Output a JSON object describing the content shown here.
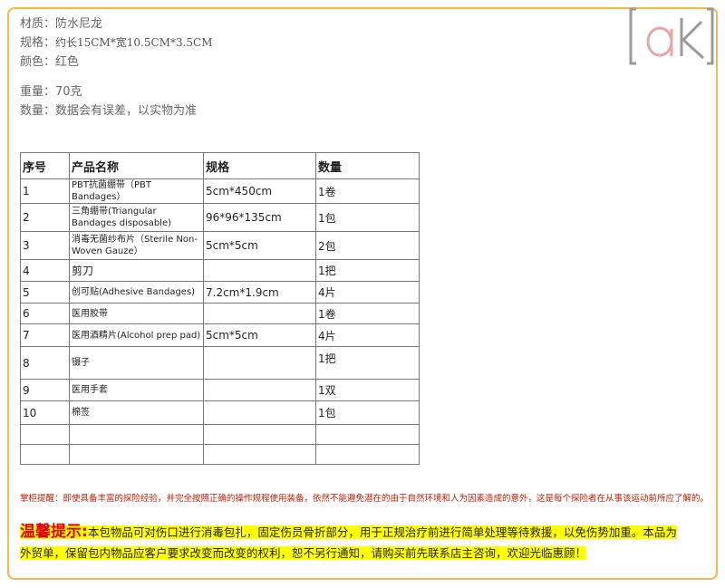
{
  "specs": {
    "material_label": "材质：",
    "material_value": "防水尼龙",
    "size_label": "规格：",
    "size_value": "约长15CM*宽10.5CM*3.5CM",
    "color_label": "颜色：",
    "color_value": "红色",
    "weight_label": "重量：",
    "weight_value": "70克",
    "quantity_label": "数量：",
    "quantity_value": "数据会有误差，以实物为准"
  },
  "table": {
    "headers": [
      "序号",
      "产品名称",
      "规格",
      "数量"
    ],
    "rows": [
      {
        "no": "1",
        "name": "PBT抗菌绷带（PBT Bandages）",
        "spec": "5cm*450cm",
        "qty": "1卷"
      },
      {
        "no": "2",
        "name": "三角绷带(Triangular Bandages disposable)",
        "spec": "96*96*135cm",
        "qty": "1包"
      },
      {
        "no": "3",
        "name": "消毒无菌纱布片（Sterile Non-Woven Gauze）",
        "spec": "5cm*5cm",
        "qty": "2包"
      },
      {
        "no": "4",
        "name": "剪刀",
        "spec": "",
        "qty": "1把"
      },
      {
        "no": "5",
        "name": "创可贴(Adhesive Bandages)",
        "spec": "7.2cm*1.9cm",
        "qty": "4片"
      },
      {
        "no": "6",
        "name": "医用胶带",
        "spec": "",
        "qty": "1卷"
      },
      {
        "no": "7",
        "name": "医用酒精片(Alcohol prep pad)",
        "spec": "5cm*5cm",
        "qty": "4片"
      },
      {
        "no": "8",
        "name": "镊子",
        "spec": "",
        "qty": "1把"
      },
      {
        "no": "9",
        "name": "医用手套",
        "spec": "",
        "qty": "1双"
      },
      {
        "no": "10",
        "name": "棉签",
        "spec": "",
        "qty": "1包"
      },
      {
        "no": "",
        "name": "",
        "spec": "",
        "qty": ""
      },
      {
        "no": "",
        "name": "",
        "spec": "",
        "qty": ""
      }
    ]
  },
  "warning": "掌柜提醒：即使具备丰富的探险经验，并完全按照正确的操作规程使用装备，依然不能避免潜在的由于自然环境和人为因素造成的意外，这是每个探险者在从事该运动前所应了解的。",
  "notice": {
    "title": "温馨提示:",
    "line1": "本包物品可对伤口进行消毒包扎，固定伤员骨折部分，用于正规治疗前进行简单处理等待救援，以免伤势加重。本品为",
    "line2": "外贸单，保留包内物品应客户要求改变而改变的权利，恕不另行通知，请购买前先联系店主咨询，欢迎光临惠顾！"
  },
  "logo": {
    "text": "ak"
  },
  "colors": {
    "border": "#f2b84b",
    "warning": "#cc1a00",
    "highlight": "#ffff00",
    "logo_grey": "#9a9a9a",
    "logo_pink": "#e8a6a6"
  }
}
